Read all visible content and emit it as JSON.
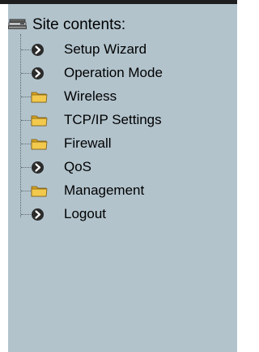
{
  "header": {
    "title": "Site contents:",
    "icon": "computer-icon"
  },
  "menu": [
    {
      "label": "Setup Wizard",
      "icon": "arrow-circle-icon",
      "type": "page"
    },
    {
      "label": "Operation Mode",
      "icon": "arrow-circle-icon",
      "type": "page"
    },
    {
      "label": "Wireless",
      "icon": "folder-icon",
      "type": "folder"
    },
    {
      "label": "TCP/IP Settings",
      "icon": "folder-icon",
      "type": "folder"
    },
    {
      "label": "Firewall",
      "icon": "folder-icon",
      "type": "folder"
    },
    {
      "label": "QoS",
      "icon": "arrow-circle-icon",
      "type": "page"
    },
    {
      "label": "Management",
      "icon": "folder-icon",
      "type": "folder"
    },
    {
      "label": "Logout",
      "icon": "arrow-circle-icon",
      "type": "page"
    }
  ],
  "colors": {
    "panel": "#b2c3cc",
    "folder": "#f2c94c",
    "arrow_circle": "#2b2b2b"
  }
}
